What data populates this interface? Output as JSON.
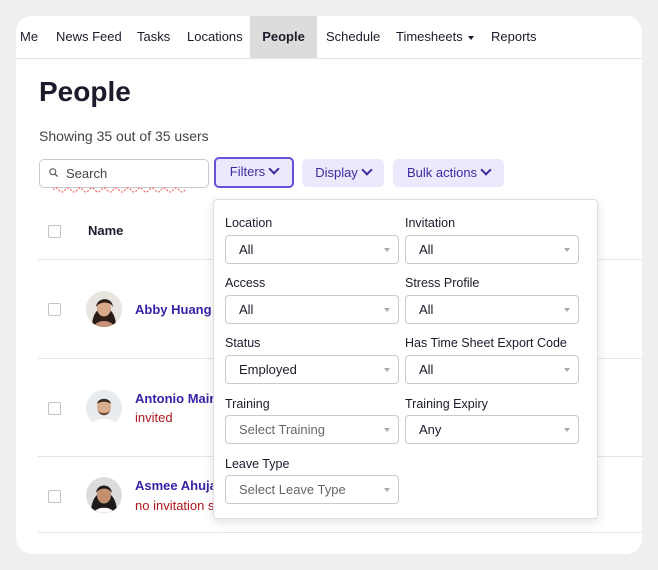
{
  "nav": {
    "items": [
      {
        "label": "Me"
      },
      {
        "label": "News Feed"
      },
      {
        "label": "Tasks"
      },
      {
        "label": "Locations"
      },
      {
        "label": "People",
        "active": true
      },
      {
        "label": "Schedule"
      },
      {
        "label": "Timesheets",
        "dropdown": true
      },
      {
        "label": "Reports"
      }
    ]
  },
  "page": {
    "title": "People",
    "showing": "Showing 35 out of 35 users"
  },
  "search": {
    "placeholder": "Search"
  },
  "toolbar": {
    "filters_label": "Filters",
    "display_label": "Display",
    "bulk_label": "Bulk actions"
  },
  "table": {
    "name_header": "Name",
    "rows": [
      {
        "name": "Abby Huang",
        "status": ""
      },
      {
        "name": "Antonio Mair",
        "status": "invited"
      },
      {
        "name": "Asmee Ahuja",
        "status": "no invitation sent"
      }
    ]
  },
  "filters": {
    "location": {
      "label": "Location",
      "value": "All"
    },
    "invitation": {
      "label": "Invitation",
      "value": "All"
    },
    "access": {
      "label": "Access",
      "value": "All"
    },
    "stress_profile": {
      "label": "Stress Profile",
      "value": "All"
    },
    "status": {
      "label": "Status",
      "value": "Employed"
    },
    "timesheet_code": {
      "label": "Has Time Sheet Export Code",
      "value": "All"
    },
    "training": {
      "label": "Training",
      "placeholder": "Select Training"
    },
    "training_expiry": {
      "label": "Training Expiry",
      "value": "Any"
    },
    "leave_type": {
      "label": "Leave Type",
      "placeholder": "Select Leave Type"
    }
  },
  "colors": {
    "accent": "#6b4fd8",
    "button_bg": "#ebe9fb",
    "link": "#3a1fa6",
    "status_red": "#b0171d",
    "annotation": "#f26b6b"
  }
}
